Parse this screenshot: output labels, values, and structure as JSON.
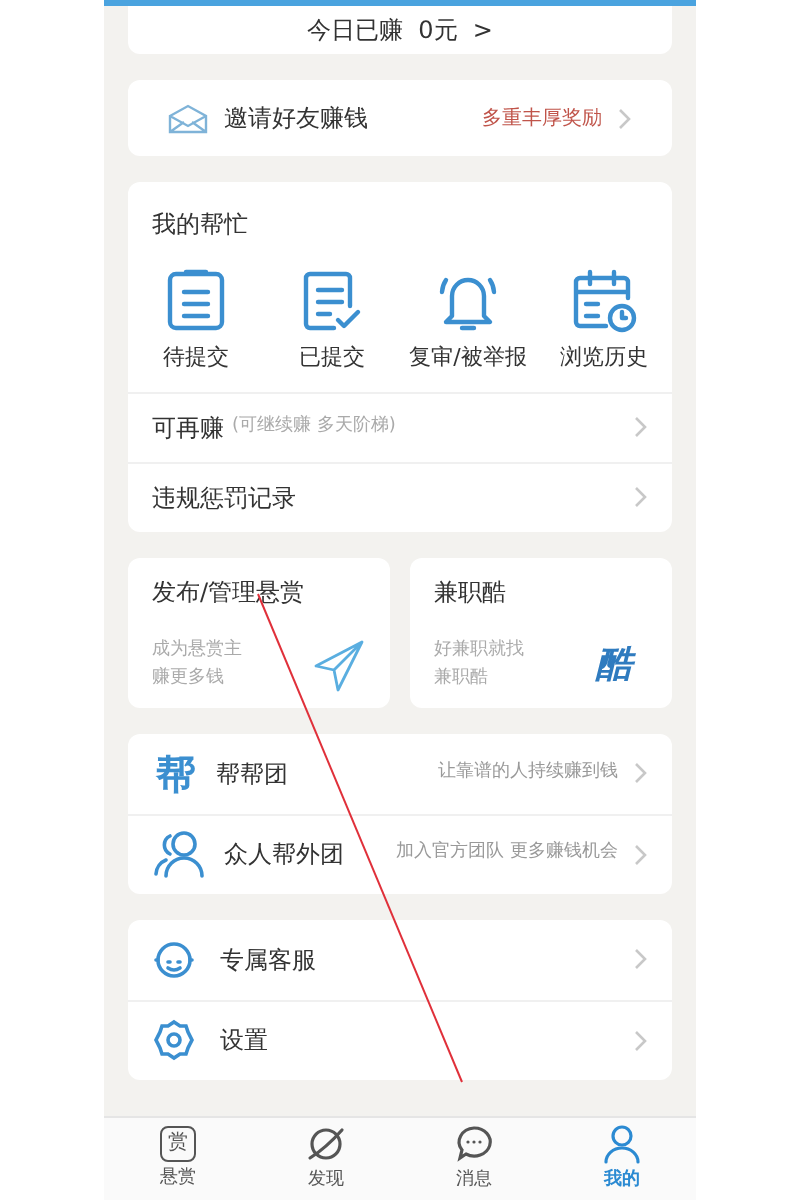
{
  "earnings": {
    "text": "今日已赚  0元  >"
  },
  "invite": {
    "label": "邀请好友赚钱",
    "note": "多重丰厚奖励"
  },
  "my_help": {
    "title": "我的帮忙",
    "actions": [
      {
        "kind": "clipboard",
        "label": "待提交"
      },
      {
        "kind": "checked",
        "label": "已提交"
      },
      {
        "kind": "bell",
        "label": "复审/被举报"
      },
      {
        "kind": "calendar",
        "label": "浏览历史"
      }
    ],
    "rows": [
      {
        "label": "可再赚",
        "note": "(可继续赚 多天阶梯)"
      },
      {
        "label": "违规惩罚记录"
      }
    ]
  },
  "promo_cards": [
    {
      "kind": "plane",
      "title": "发布/管理悬赏",
      "subtitle": "成为悬赏主赚更多钱"
    },
    {
      "kind": "logo",
      "title": "兼职酷",
      "subtitle": "好兼职就找兼职酷",
      "logo_text": "酷"
    }
  ],
  "groups": [
    {
      "kind": "help",
      "icon_text": "帮",
      "label": "帮帮团",
      "note": "让靠谱的人持续赚到钱"
    },
    {
      "kind": "people",
      "label": "众人帮外团",
      "note": "加入官方团队 更多赚钱机会"
    }
  ],
  "services": [
    {
      "kind": "agent",
      "label": "专属客服"
    },
    {
      "kind": "gear",
      "label": "设置"
    }
  ],
  "tabs": [
    {
      "kind": "reward",
      "icon_text": "赏",
      "label": "悬赏",
      "selected": false
    },
    {
      "kind": "planet",
      "label": "发现",
      "selected": false
    },
    {
      "kind": "chat",
      "label": "消息",
      "selected": false
    },
    {
      "kind": "person",
      "label": "我的",
      "selected": true
    }
  ]
}
